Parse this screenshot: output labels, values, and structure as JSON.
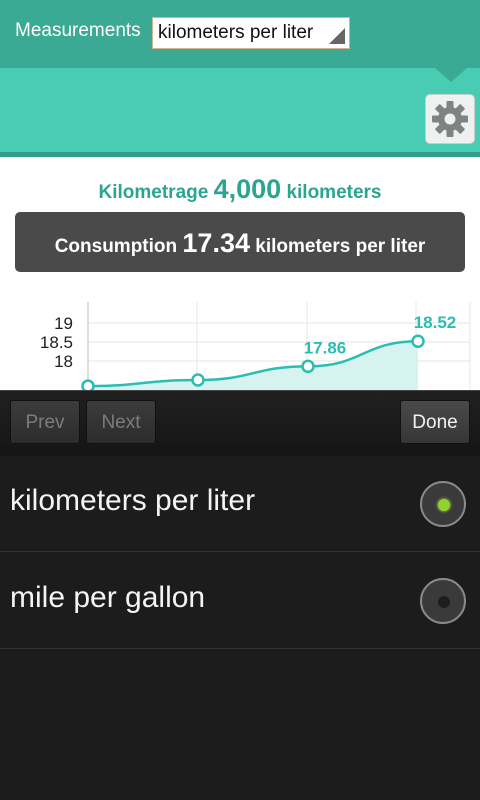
{
  "topbar": {
    "label": "Measurements",
    "select_value": "kilometers per liter"
  },
  "summary": {
    "kilometrage_label": "Kilometrage",
    "kilometrage_value": "4,000",
    "kilometrage_unit": "kilometers",
    "consumption_label": "Consumption",
    "consumption_value": "17.34",
    "consumption_unit": "kilometers per liter"
  },
  "chart_data": {
    "type": "area",
    "y_ticks": [
      "19",
      "18.5",
      "18"
    ],
    "ylim": [
      17.2,
      19.2
    ],
    "x": [
      0,
      1,
      2,
      3
    ],
    "values": [
      17.34,
      17.5,
      17.86,
      18.52
    ],
    "data_labels": [
      "17.86",
      "18.52"
    ],
    "labeled_indices": [
      2,
      3
    ],
    "grid": true,
    "colors": {
      "line": "#2bbdb2",
      "fill": "#d7f3f0"
    }
  },
  "picker": {
    "prev_label": "Prev",
    "next_label": "Next",
    "done_label": "Done",
    "options": [
      {
        "label": "kilometers per liter",
        "checked": true
      },
      {
        "label": "mile per gallon",
        "checked": false
      }
    ]
  },
  "colors": {
    "header": "#3aaa94",
    "band": "#48ccb3",
    "accent": "#2aa590",
    "radio_on": "#8fd42a"
  }
}
